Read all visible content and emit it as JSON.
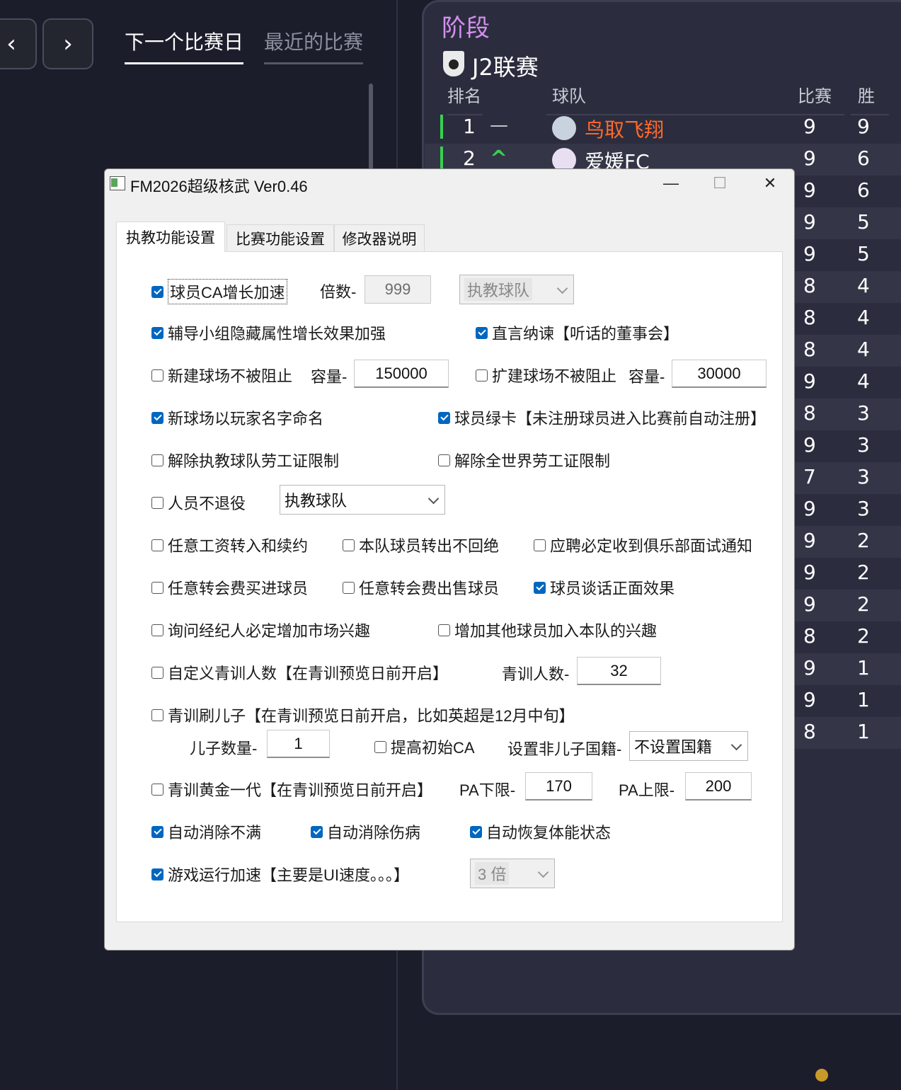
{
  "game": {
    "nav": {
      "prev_icon": "‹",
      "next_icon": "›"
    },
    "tabs": [
      "下一个比赛日",
      "最近的比赛"
    ],
    "standings": {
      "stage_title": "阶段",
      "league_name": "J2联赛",
      "headers": {
        "rank": "排名",
        "team": "球队",
        "played": "比赛",
        "won": "胜"
      },
      "rows": [
        {
          "rank": "1",
          "trend": "—",
          "team": "鸟取飞翔",
          "played": "9",
          "won": "9"
        },
        {
          "rank": "2",
          "trend": "^",
          "team": "爱媛FC",
          "played": "9",
          "won": "6"
        },
        {
          "played": "9",
          "won": "6"
        },
        {
          "played": "9",
          "won": "5"
        },
        {
          "played": "9",
          "won": "5"
        },
        {
          "played": "8",
          "won": "4"
        },
        {
          "played": "8",
          "won": "4"
        },
        {
          "played": "8",
          "won": "4"
        },
        {
          "played": "9",
          "won": "4"
        },
        {
          "played": "8",
          "won": "3"
        },
        {
          "played": "9",
          "won": "3"
        },
        {
          "played": "7",
          "won": "3"
        },
        {
          "played": "9",
          "won": "3"
        },
        {
          "played": "9",
          "won": "2"
        },
        {
          "played": "9",
          "won": "2"
        },
        {
          "played": "9",
          "won": "2"
        },
        {
          "played": "8",
          "won": "2"
        },
        {
          "played": "9",
          "won": "1"
        },
        {
          "played": "9",
          "won": "1"
        },
        {
          "played": "8",
          "won": "1"
        }
      ],
      "colors": {
        "stage": "#d58fef",
        "leader": "#ff6a2b",
        "up": "#37d14f"
      }
    }
  },
  "dialog": {
    "title": "FM2026超级核武 Ver0.46",
    "controls": {
      "minimize": "—",
      "maximize": "☐",
      "close": "✕"
    },
    "tabs": [
      "执教功能设置",
      "比赛功能设置",
      "修改器说明"
    ],
    "options": {
      "ca_growth": {
        "label": "球员CA增长加速",
        "checked": true
      },
      "multiplier_label": "倍数-",
      "multiplier_value": "999",
      "ca_scope": "执教球队",
      "mentoring": {
        "label": "辅导小组隐藏属性增长效果加强",
        "checked": true
      },
      "board": {
        "label": "直言纳谏【听话的董事会】",
        "checked": true
      },
      "new_stadium": {
        "label": "新建球场不被阻止",
        "checked": false
      },
      "new_capacity_label": "容量-",
      "new_capacity": "150000",
      "expand_stadium": {
        "label": "扩建球场不被阻止",
        "checked": false
      },
      "expand_capacity_label": "容量-",
      "expand_capacity": "30000",
      "stadium_name": {
        "label": "新球场以玩家名字命名",
        "checked": true
      },
      "green_card": {
        "label": "球员绿卡【未注册球员进入比赛前自动注册】",
        "checked": true
      },
      "work_permit_team": {
        "label": "解除执教球队劳工证限制",
        "checked": false
      },
      "work_permit_world": {
        "label": "解除全世界劳工证限制",
        "checked": false
      },
      "no_retire": {
        "label": "人员不退役",
        "checked": false
      },
      "no_retire_scope": "执教球队",
      "any_wage": {
        "label": "任意工资转入和续约",
        "checked": false
      },
      "no_refuse": {
        "label": "本队球员转出不回绝",
        "checked": false
      },
      "interview": {
        "label": "应聘必定收到俱乐部面试通知",
        "checked": false
      },
      "any_fee_buy": {
        "label": "任意转会费买进球员",
        "checked": false
      },
      "any_fee_sell": {
        "label": "任意转会费出售球员",
        "checked": false
      },
      "talk_positive": {
        "label": "球员谈话正面效果",
        "checked": true
      },
      "agent_interest": {
        "label": "询问经纪人必定增加市场兴趣",
        "checked": false
      },
      "join_interest": {
        "label": "增加其他球员加入本队的兴趣",
        "checked": false
      },
      "youth_count": {
        "label": "自定义青训人数【在青训预览日前开启】",
        "checked": false
      },
      "youth_count_label": "青训人数-",
      "youth_count_value": "32",
      "youth_son": {
        "label": "青训刷儿子【在青训预览日前开启，比如英超是12月中旬】",
        "checked": false
      },
      "son_count_label": "儿子数量-",
      "son_count_value": "1",
      "raise_ca": {
        "label": "提高初始CA",
        "checked": false
      },
      "nationality_label": "设置非儿子国籍-",
      "nationality_value": "不设置国籍",
      "golden_gen": {
        "label": "青训黄金一代【在青训预览日前开启】",
        "checked": false
      },
      "pa_min_label": "PA下限-",
      "pa_min": "170",
      "pa_max_label": "PA上限-",
      "pa_max": "200",
      "auto_unhappy": {
        "label": "自动消除不满",
        "checked": true
      },
      "auto_injury": {
        "label": "自动消除伤病",
        "checked": true
      },
      "auto_fitness": {
        "label": "自动恢复体能状态",
        "checked": true
      },
      "speedup": {
        "label": "游戏运行加速【主要是UI速度。。。】",
        "checked": true
      },
      "speed_value": "3 倍"
    },
    "colors": {
      "check_on": "#0067c0"
    }
  }
}
